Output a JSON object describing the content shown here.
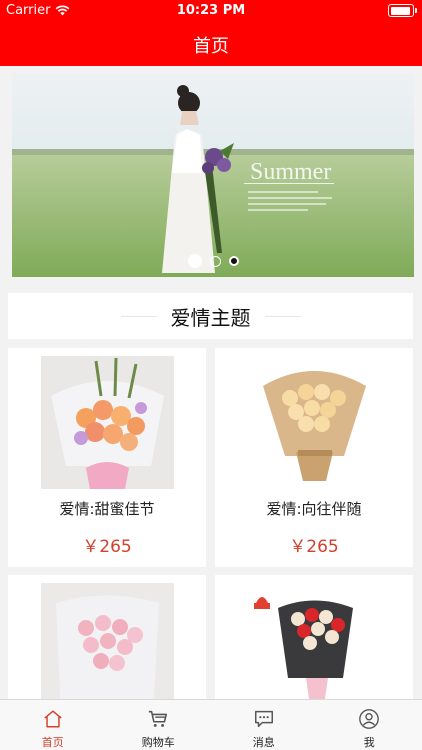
{
  "status_bar": {
    "carrier": "Carrier",
    "time": "10:23 PM",
    "battery_level": 0.95
  },
  "nav": {
    "title": "首页"
  },
  "banner": {
    "overlay_text": "Summer",
    "slide_count": 3,
    "active_slide": 1
  },
  "section": {
    "title": "爱情主题"
  },
  "products": [
    {
      "name": "爱情:甜蜜佳节",
      "price": "￥265"
    },
    {
      "name": "爱情:向往伴随",
      "price": "￥265"
    },
    {
      "name": "",
      "price": ""
    },
    {
      "name": "",
      "price": ""
    }
  ],
  "tabbar": {
    "items": [
      {
        "label": "首页",
        "icon": "home-icon",
        "active": true
      },
      {
        "label": "购物车",
        "icon": "cart-icon",
        "active": false
      },
      {
        "label": "消息",
        "icon": "message-icon",
        "active": false
      },
      {
        "label": "我",
        "icon": "user-icon",
        "active": false
      }
    ]
  },
  "colors": {
    "brand": "#ff0000",
    "price": "#d2412d",
    "background": "#f2f2f2"
  }
}
